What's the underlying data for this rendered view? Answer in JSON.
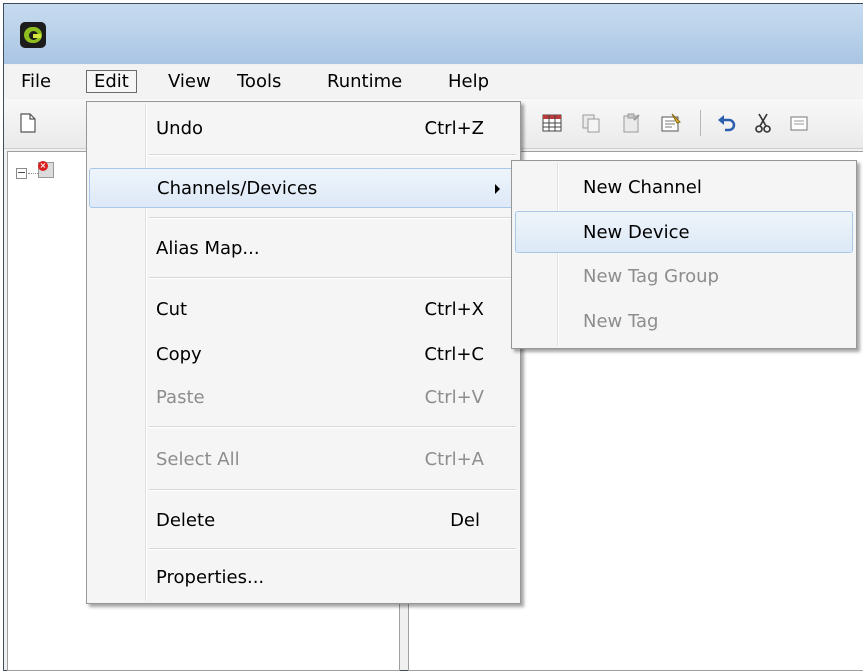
{
  "menubar": {
    "items": [
      {
        "label": "File"
      },
      {
        "label": "Edit"
      },
      {
        "label": "View"
      },
      {
        "label": "Tools"
      },
      {
        "label": "Runtime"
      },
      {
        "label": "Help"
      }
    ],
    "active": "Edit"
  },
  "edit_menu": {
    "items": [
      {
        "label": "Undo",
        "shortcut": "Ctrl+Z",
        "enabled": true
      },
      {
        "label": "Channels/Devices",
        "shortcut": "",
        "enabled": true,
        "submenu": true,
        "highlighted": true
      },
      {
        "label": "Alias Map...",
        "shortcut": "",
        "enabled": true
      },
      {
        "label": "Cut",
        "shortcut": "Ctrl+X",
        "enabled": true
      },
      {
        "label": "Copy",
        "shortcut": "Ctrl+C",
        "enabled": true
      },
      {
        "label": "Paste",
        "shortcut": "Ctrl+V",
        "enabled": false
      },
      {
        "label": "Select All",
        "shortcut": "Ctrl+A",
        "enabled": false
      },
      {
        "label": "Delete",
        "shortcut": "Del",
        "enabled": true
      },
      {
        "label": "Properties...",
        "shortcut": "",
        "enabled": true
      }
    ]
  },
  "submenu": {
    "items": [
      {
        "label": "New Channel",
        "enabled": true
      },
      {
        "label": "New Device",
        "enabled": true,
        "highlighted": true
      },
      {
        "label": "New Tag Group",
        "enabled": false
      },
      {
        "label": "New Tag",
        "enabled": false
      }
    ]
  },
  "toolbar": {
    "icons": [
      "new-file-icon",
      "grid-icon",
      "copy-icon",
      "paste-icon",
      "properties-icon",
      "undo-icon",
      "cut-icon",
      "more-icon"
    ]
  },
  "colors": {
    "highlight_border": "#a8c8ea",
    "disabled_text": "#8d8d8d",
    "titlebar": "#b9d1ea"
  }
}
